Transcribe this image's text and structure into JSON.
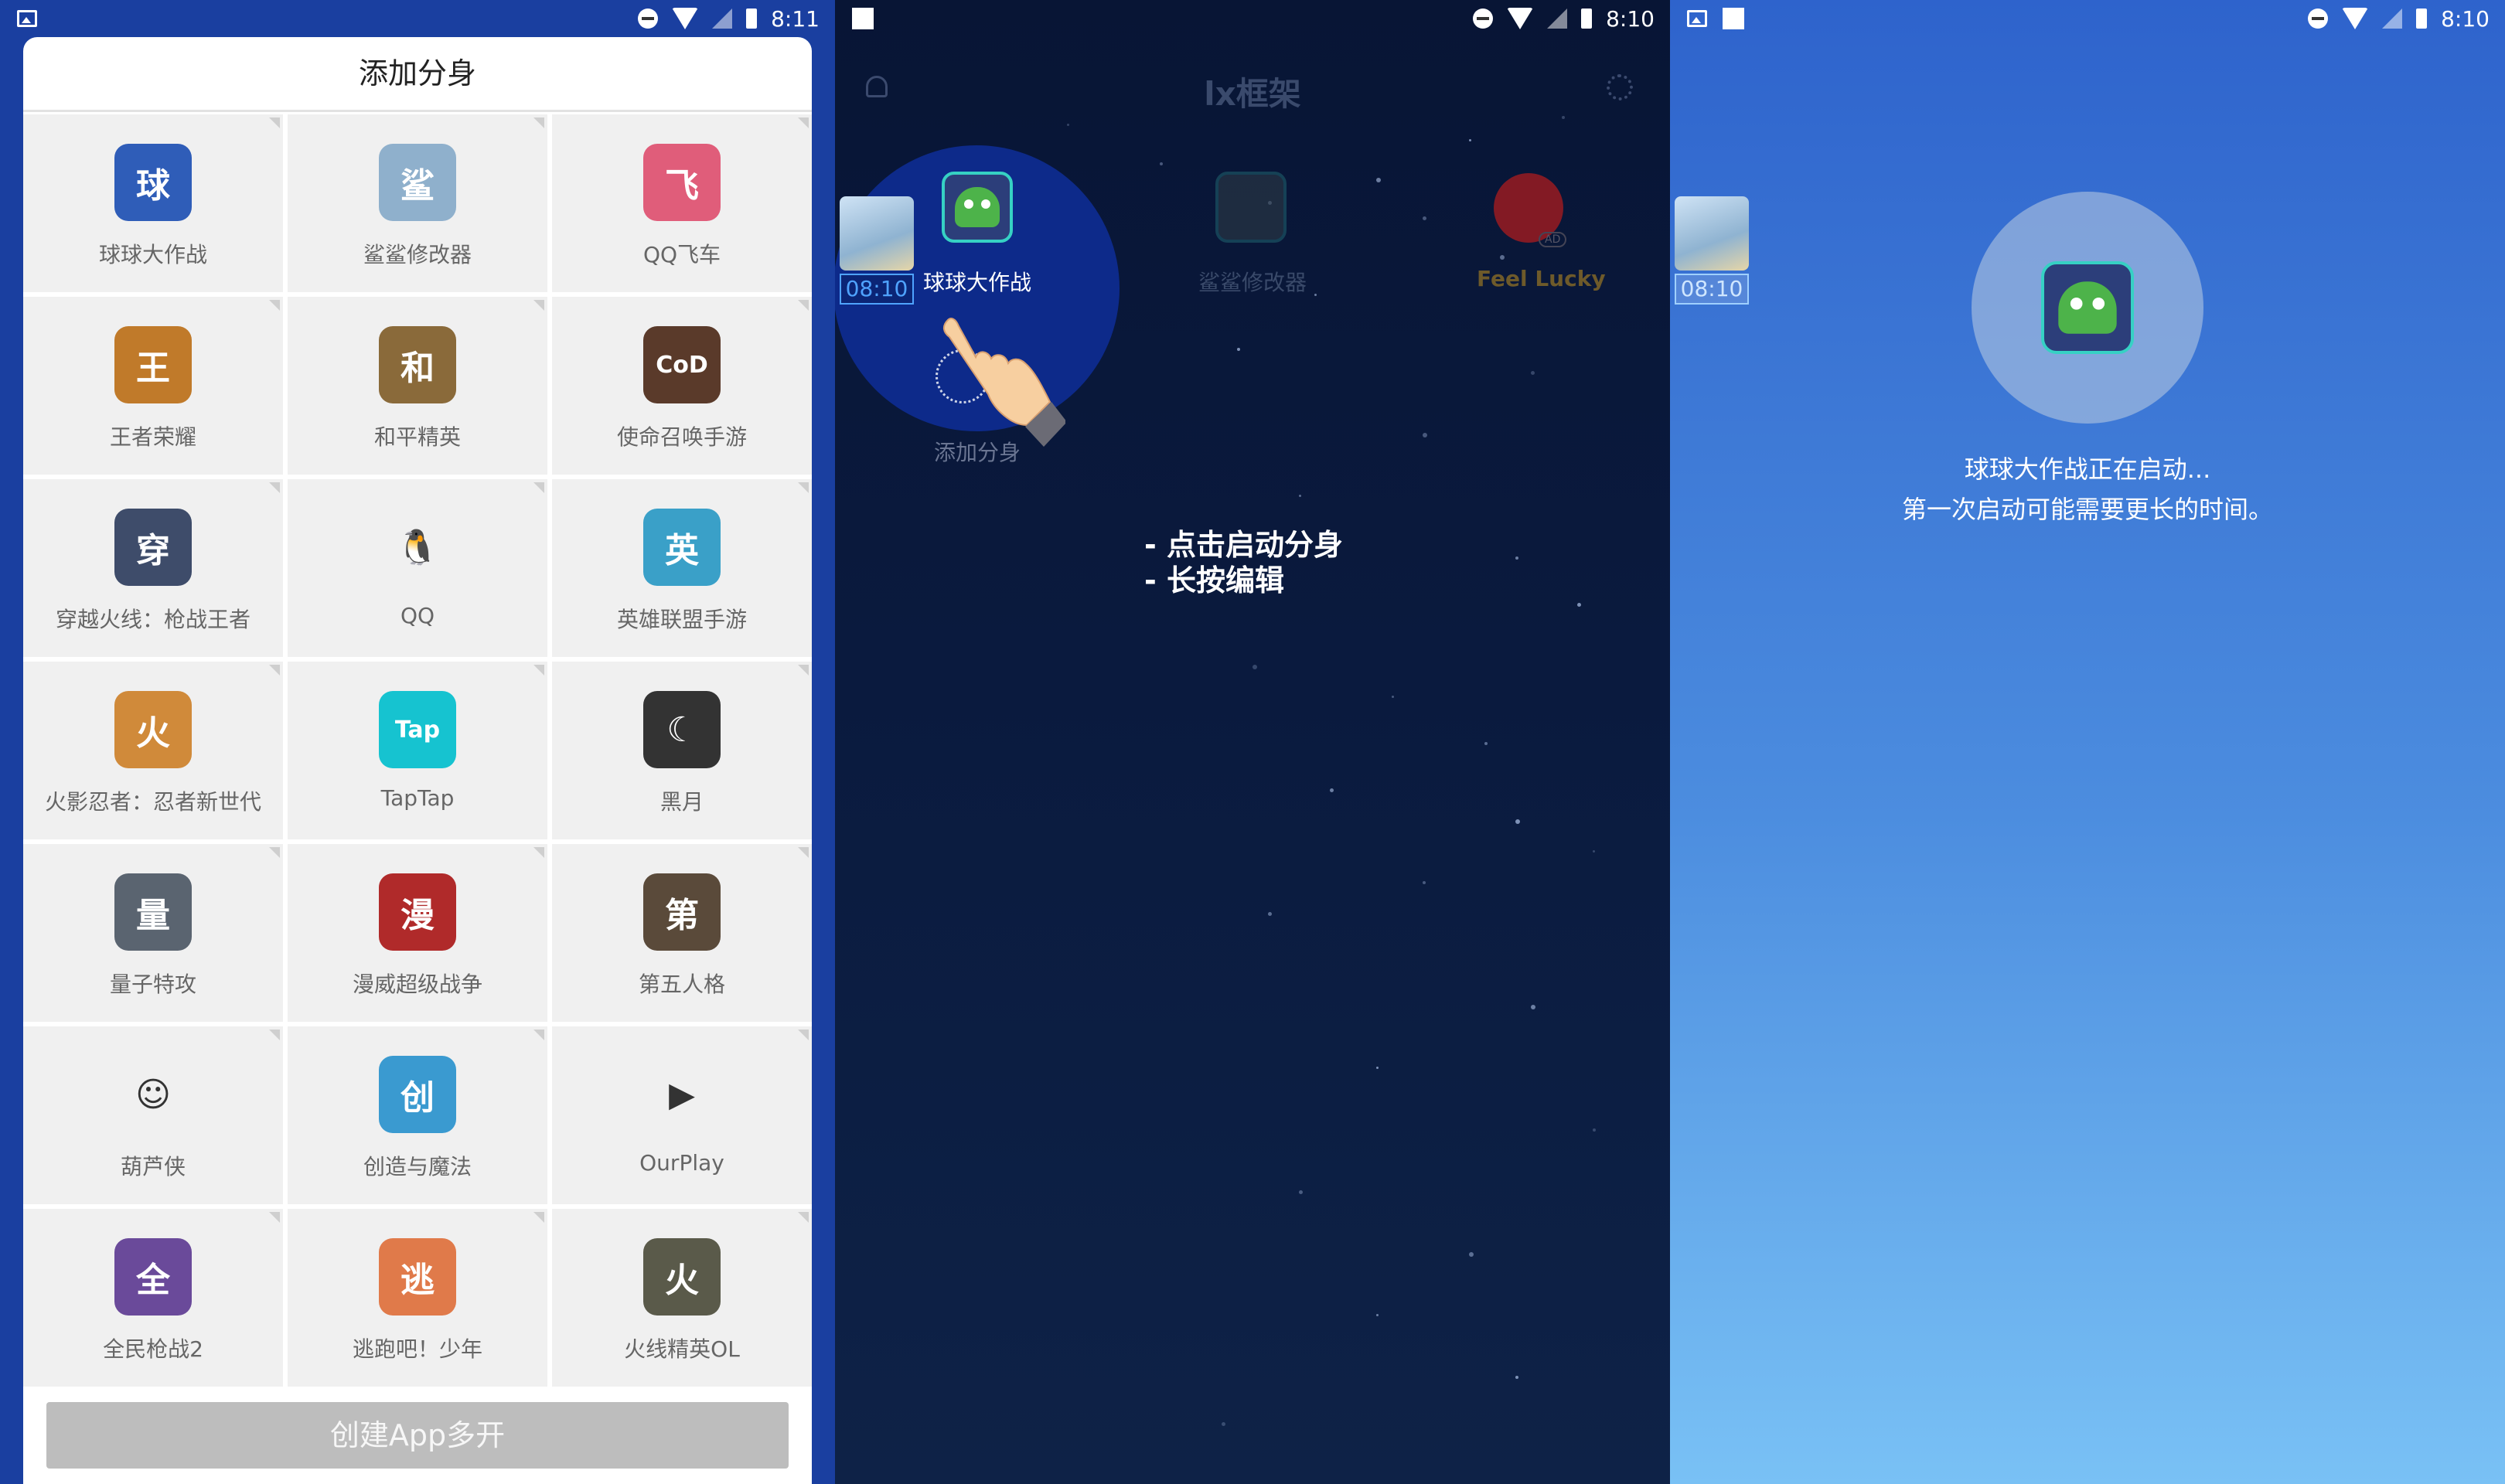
{
  "panel1": {
    "status": {
      "time": "8:11"
    },
    "title": "添加分身",
    "apps": [
      {
        "name": "球球大作战",
        "icon": "ball-battle-icon",
        "glyph": "球",
        "color": "#2f5db8"
      },
      {
        "name": "鲨鲨修改器",
        "icon": "shark-modifier-icon",
        "glyph": "鲨",
        "color": "#8fb0cc"
      },
      {
        "name": "QQ飞车",
        "icon": "qq-speed-icon",
        "glyph": "飞",
        "color": "#e05d7a"
      },
      {
        "name": "王者荣耀",
        "icon": "honor-of-kings-icon",
        "glyph": "王",
        "color": "#c07a2a"
      },
      {
        "name": "和平精英",
        "icon": "peace-elite-icon",
        "glyph": "和",
        "color": "#8a6a3a"
      },
      {
        "name": "使命召唤手游",
        "icon": "call-of-duty-icon",
        "glyph": "CoD",
        "color": "#5a3a2a"
      },
      {
        "name": "穿越火线：枪战王者",
        "icon": "crossfire-icon",
        "glyph": "穿",
        "color": "#3e4c6a"
      },
      {
        "name": "QQ",
        "icon": "qq-penguin-icon",
        "glyph": "🐧",
        "color": "#f0f0f0"
      },
      {
        "name": "英雄联盟手游",
        "icon": "lol-mobile-icon",
        "glyph": "英",
        "color": "#3aa0c8"
      },
      {
        "name": "火影忍者：忍者新世代",
        "icon": "naruto-icon",
        "glyph": "火",
        "color": "#d08a3a"
      },
      {
        "name": "TapTap",
        "icon": "taptap-icon",
        "glyph": "Tap",
        "color": "#16c3d0"
      },
      {
        "name": "黑月",
        "icon": "black-moon-icon",
        "glyph": "☾",
        "color": "#333333"
      },
      {
        "name": "量子特攻",
        "icon": "quantum-ops-icon",
        "glyph": "量",
        "color": "#5a6470"
      },
      {
        "name": "漫威超级战争",
        "icon": "marvel-icon",
        "glyph": "漫",
        "color": "#b02a2a"
      },
      {
        "name": "第五人格",
        "icon": "identity-v-icon",
        "glyph": "第",
        "color": "#5a4a3a"
      },
      {
        "name": "葫芦侠",
        "icon": "huluxia-icon",
        "glyph": "☺",
        "color": "#f0f0f0"
      },
      {
        "name": "创造与魔法",
        "icon": "create-magic-icon",
        "glyph": "创",
        "color": "#3a9ad0"
      },
      {
        "name": "OurPlay",
        "icon": "ourplay-icon",
        "glyph": "▶",
        "color": "#f0f0f0"
      },
      {
        "name": "全民枪战2",
        "icon": "national-gunfight-icon",
        "glyph": "全",
        "color": "#6a4a9a"
      },
      {
        "name": "逃跑吧！少年",
        "icon": "run-boy-icon",
        "glyph": "逃",
        "color": "#e07a4a"
      },
      {
        "name": "火线精英OL",
        "icon": "crossfire-elite-icon",
        "glyph": "火",
        "color": "#5a5a4a"
      }
    ],
    "create_button": "创建App多开"
  },
  "panel2": {
    "status": {
      "time": "8:10"
    },
    "title": "lx框架",
    "shark_time": "08:10",
    "highlight_label": "球球大作战",
    "modifier_label": "鲨鲨修改器",
    "lucky_label": "Feel Lucky",
    "ad_badge": "AD",
    "add_label": "添加分身",
    "instructions": [
      "- 点击启动分身",
      "- 长按编辑"
    ]
  },
  "panel3": {
    "status": {
      "time": "8:10"
    },
    "shark_time": "08:10",
    "launching_text": "球球大作战正在启动...",
    "hint_text": "第一次启动可能需要更长的时间。"
  }
}
